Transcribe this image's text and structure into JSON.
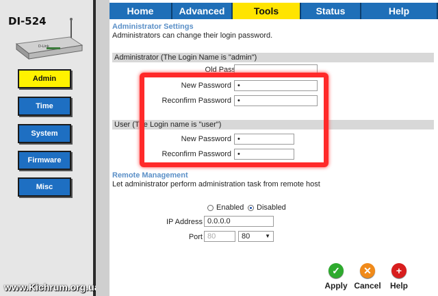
{
  "device": {
    "model": "DI-524"
  },
  "sidebar": {
    "items": [
      {
        "label": "Admin",
        "active": true
      },
      {
        "label": "Time",
        "active": false
      },
      {
        "label": "System",
        "active": false
      },
      {
        "label": "Firmware",
        "active": false
      },
      {
        "label": "Misc",
        "active": false
      }
    ]
  },
  "tabs": [
    {
      "label": "Home",
      "active": false
    },
    {
      "label": "Advanced",
      "active": false
    },
    {
      "label": "Tools",
      "active": true
    },
    {
      "label": "Status",
      "active": false
    },
    {
      "label": "Help",
      "active": false
    }
  ],
  "admin_settings": {
    "title": "Administrator Settings",
    "description": "Administrators can change their login password."
  },
  "administrator": {
    "header": "Administrator (The Login Name is \"admin\")",
    "old_password_label": "Old Password",
    "new_password_label": "New Password",
    "new_password_value": "•",
    "reconfirm_label": "Reconfirm Password",
    "reconfirm_value": "•"
  },
  "user": {
    "header": "User (The Login name is \"user\")",
    "new_password_label": "New Password",
    "new_password_value": "•",
    "reconfirm_label": "Reconfirm Password",
    "reconfirm_value": "•"
  },
  "remote": {
    "title": "Remote Management",
    "description": "Let administrator perform administration task from remote host",
    "enabled_label": "Enabled",
    "disabled_label": "Disabled",
    "selected": "Disabled",
    "ip_label": "IP Address",
    "ip_value": "0.0.0.0",
    "port_label": "Port",
    "port_value": "80",
    "port_select": "80"
  },
  "actions": {
    "apply": "Apply",
    "cancel": "Cancel",
    "help": "Help"
  },
  "watermark": "www.Kichrum.org.ua",
  "colors": {
    "nav_blue": "#1e6fc2",
    "nav_active": "#fff200",
    "tab_blue": "#1f6fb8",
    "tab_active": "#ffe400",
    "highlight_red": "#ff2a2a",
    "section_title": "#5a8fc7"
  }
}
